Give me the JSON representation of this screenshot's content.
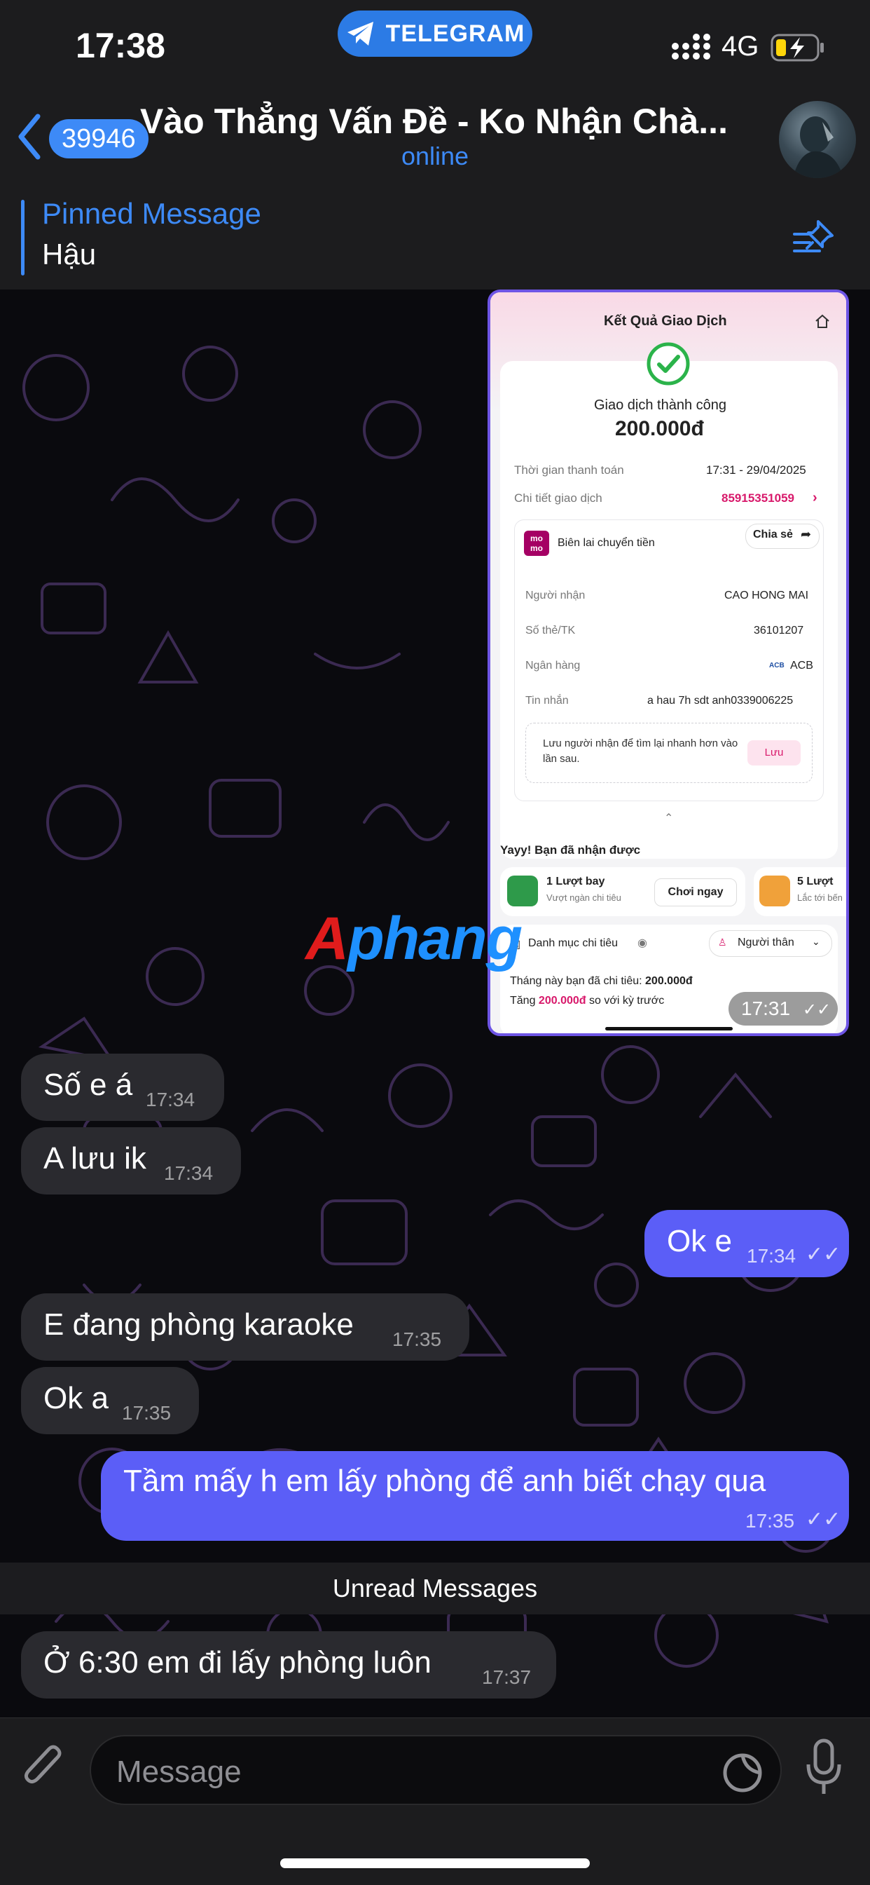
{
  "status_bar": {
    "time": "17:38",
    "app_pill": "TELEGRAM",
    "network": "4G"
  },
  "header": {
    "back_badge": "39946",
    "title": "Vào Thẳng Vấn Đề - Ko Nhận Chà...",
    "status": "online"
  },
  "pinned": {
    "title": "Pinned Message",
    "text": "Hậu"
  },
  "screenshot": {
    "header_title": "Kết Quả Giao Dịch",
    "success_text": "Giao dịch thành công",
    "amount": "200.000đ",
    "time_label": "Thời gian thanh toán",
    "time_value": "17:31 - 29/04/2025",
    "detail_label": "Chi tiết giao dịch",
    "detail_value": "85915351059",
    "momo_logo": "mo mo",
    "receipt_title": "Biên lai chuyển tiền",
    "share_label": "Chia sẻ",
    "rows": [
      {
        "label": "Người nhận",
        "value": "CAO HONG MAI"
      },
      {
        "label": "Số thẻ/TK",
        "value": "36101207"
      },
      {
        "label": "Ngân hàng",
        "value": "ACB"
      },
      {
        "label": "Tin nhắn",
        "value": "a hau 7h sdt anh0339006225"
      }
    ],
    "bank_logo": "ACB",
    "save_tip": "Lưu người nhận để tìm lại nhanh hơn vào lần sau.",
    "save_button": "Lưu",
    "reward_title": "Yayy! Bạn đã nhận được",
    "reward1_title": "1 Lượt bay",
    "reward1_sub": "Vượt ngàn chi tiêu",
    "reward1_button": "Chơi ngay",
    "reward2_title": "5 Lượt",
    "reward2_sub": "Lắc tới bến",
    "category_label": "Danh mục chi tiêu",
    "category_value": "Người thân",
    "spent_line_prefix": "Tháng này bạn đã chi tiêu:",
    "spent_amount": "200.000đ",
    "increase_prefix": "Tăng",
    "increase_amount": "200.000đ",
    "increase_suffix": "so với kỳ trước",
    "time": "17:31"
  },
  "watermark": {
    "a": "A",
    "rest": "phang"
  },
  "messages": [
    {
      "text": "Số e á",
      "time": "17:34"
    },
    {
      "text": "A lưu ik",
      "time": "17:34"
    },
    {
      "text": "Ok e",
      "time": "17:34"
    },
    {
      "text": "E đang phòng karaoke",
      "time": "17:35"
    },
    {
      "text": "Ok a",
      "time": "17:35"
    },
    {
      "text": "Tầm mấy h em lấy phòng để anh biết chạy qua",
      "time": "17:35"
    },
    {
      "text": "Ở 6:30 em đi lấy phòng luôn",
      "time": "17:37"
    }
  ],
  "unread_divider": "Unread Messages",
  "input": {
    "placeholder": "Message"
  },
  "colors": {
    "accent": "#3d8af7",
    "outgoing": "#5b5ef7",
    "incoming": "#2a2a2f",
    "momo": "#a50064"
  }
}
